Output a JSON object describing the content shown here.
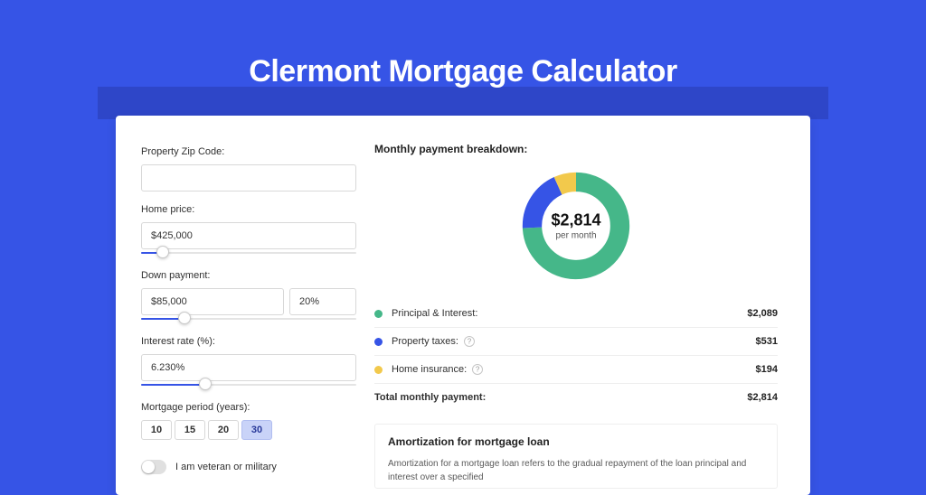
{
  "title": "Clermont Mortgage Calculator",
  "form": {
    "zip_label": "Property Zip Code:",
    "zip_value": "",
    "home_price_label": "Home price:",
    "home_price_value": "$425,000",
    "down_payment_label": "Down payment:",
    "down_payment_value": "$85,000",
    "down_payment_percent_value": "20%",
    "interest_label": "Interest rate (%):",
    "interest_value": "6.230%",
    "period_label": "Mortgage period (years):",
    "period_options": [
      "10",
      "15",
      "20",
      "30"
    ],
    "period_selected": "30",
    "veteran_label": "I am veteran or military"
  },
  "breakdown": {
    "heading": "Monthly payment breakdown:",
    "center_amount": "$2,814",
    "center_sub": "per month",
    "items": [
      {
        "label": "Principal & Interest:",
        "value": "$2,089",
        "color": "#45B789",
        "info": false
      },
      {
        "label": "Property taxes:",
        "value": "$531",
        "color": "#3654E6",
        "info": true
      },
      {
        "label": "Home insurance:",
        "value": "$194",
        "color": "#F2C94C",
        "info": true
      }
    ],
    "total_label": "Total monthly payment:",
    "total_value": "$2,814"
  },
  "chart_data": {
    "type": "pie",
    "title": "Monthly payment breakdown",
    "categories": [
      "Principal & Interest",
      "Property taxes",
      "Home insurance"
    ],
    "values": [
      2089,
      531,
      194
    ],
    "colors": [
      "#45B789",
      "#3654E6",
      "#F2C94C"
    ],
    "center_label": "$2,814 per month"
  },
  "amortization": {
    "heading": "Amortization for mortgage loan",
    "text": "Amortization for a mortgage loan refers to the gradual repayment of the loan principal and interest over a specified"
  }
}
